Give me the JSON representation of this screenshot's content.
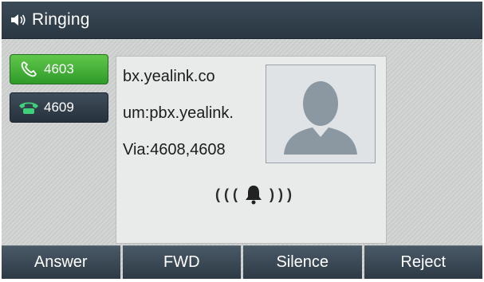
{
  "status": {
    "icon": "speaker-icon",
    "title": "Ringing"
  },
  "lines": [
    {
      "label": "4603",
      "icon": "handset-icon",
      "state": "active",
      "color": "#3fb23a"
    },
    {
      "label": "4609",
      "icon": "phone-icon",
      "state": "idle",
      "color": "#2e3b47"
    }
  ],
  "caller": {
    "line1": "bx.yealink.co",
    "line2": "um:pbx.yealink.",
    "line3": "Via:4608,4608"
  },
  "ring_indicator": {
    "left": "( ( (",
    "right": ") ) )",
    "icon": "bell-icon"
  },
  "softkeys": [
    "Answer",
    "FWD",
    "Silence",
    "Reject"
  ]
}
